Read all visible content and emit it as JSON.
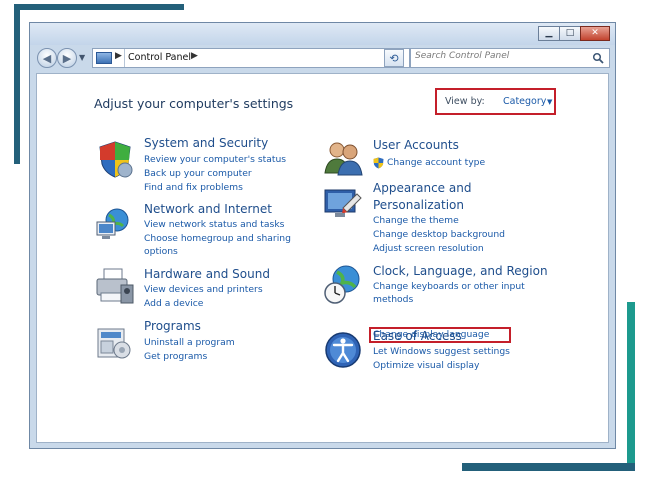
{
  "navigation": {
    "breadcrumb": "Control Panel",
    "search_placeholder": "Search Control Panel"
  },
  "header": {
    "title": "Adjust your computer's settings",
    "view_by_label": "View by:",
    "view_by_value": "Category"
  },
  "categories": {
    "system_security": {
      "title": "System and Security",
      "links": [
        "Review your computer's status",
        "Back up your computer",
        "Find and fix problems"
      ]
    },
    "network_internet": {
      "title": "Network and Internet",
      "links": [
        "View network status and tasks",
        "Choose homegroup and sharing",
        "options"
      ]
    },
    "hardware_sound": {
      "title": "Hardware and Sound",
      "links": [
        "View devices and printers",
        "Add a device"
      ]
    },
    "programs": {
      "title": "Programs",
      "links": [
        "Uninstall a program",
        "Get programs"
      ]
    },
    "user_accounts": {
      "title": "User Accounts",
      "links": [
        "Change account type"
      ]
    },
    "appearance": {
      "title_line1": "Appearance and",
      "title_line2": "Personalization",
      "links": [
        "Change the theme",
        "Change desktop background",
        "Adjust screen resolution"
      ]
    },
    "clock_language": {
      "title": "Clock, Language, and Region",
      "links": [
        "Change keyboards or other input",
        "methods",
        "Change display language"
      ]
    },
    "ease_access": {
      "title": "Ease of Access",
      "links": [
        "Let Windows suggest settings",
        "Optimize visual display"
      ]
    }
  },
  "colors": {
    "link": "#1b5aa8",
    "title": "#1f4e8c",
    "highlight": "#c41f2a"
  },
  "icons": [
    "shield-icon",
    "network-icon",
    "printer-icon",
    "programs-icon",
    "users-icon",
    "display-icon",
    "globe-clock-icon",
    "accessibility-icon",
    "uac-shield-icon",
    "search-icon",
    "refresh-icon"
  ]
}
